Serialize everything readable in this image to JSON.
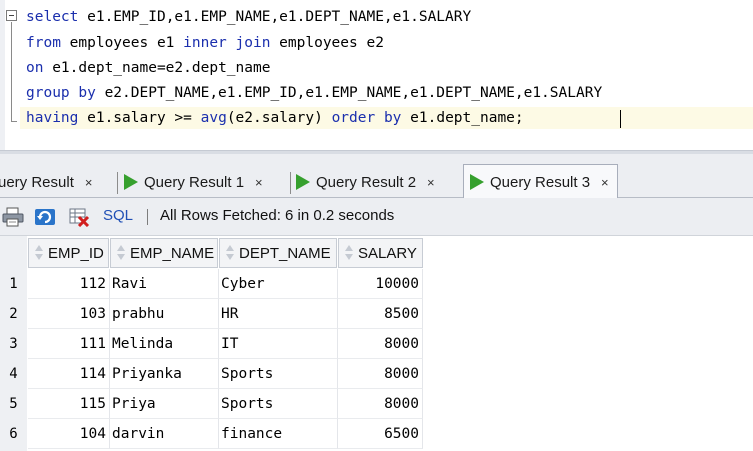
{
  "editor": {
    "lines": [
      [
        {
          "t": "select",
          "k": true
        },
        {
          "t": " e1.EMP_ID,e1.EMP_NAME,e1.DEPT_NAME,e1.SALARY",
          "k": false
        }
      ],
      [
        {
          "t": "from",
          "k": true
        },
        {
          "t": " employees e1 ",
          "k": false
        },
        {
          "t": "inner join",
          "k": true
        },
        {
          "t": " employees e2",
          "k": false
        }
      ],
      [
        {
          "t": "on",
          "k": true
        },
        {
          "t": " e1.dept_name=e2.dept_name",
          "k": false
        }
      ],
      [
        {
          "t": "group by",
          "k": true
        },
        {
          "t": " e2.DEPT_NAME,e1.EMP_ID,e1.EMP_NAME,e1.DEPT_NAME,e1.SALARY",
          "k": false
        }
      ],
      [
        {
          "t": "having",
          "k": true
        },
        {
          "t": " e1.salary >= ",
          "k": false
        },
        {
          "t": "avg",
          "k": true
        },
        {
          "t": "(e2.salary) ",
          "k": false
        },
        {
          "t": "order by",
          "k": true
        },
        {
          "t": " e1.dept_name;",
          "k": false
        }
      ]
    ],
    "fold_icon": "minus-box-icon"
  },
  "tabs": [
    {
      "label": "uery Result",
      "close": "×",
      "icon": null
    },
    {
      "label": "Query Result 1",
      "close": "×",
      "icon": "play-icon"
    },
    {
      "label": "Query Result 2",
      "close": "×",
      "icon": "play-icon"
    },
    {
      "label": "Query Result 3",
      "close": "×",
      "icon": "play-icon",
      "active": true
    }
  ],
  "toolbar": {
    "icons": [
      "print-icon",
      "refresh-icon",
      "delete-icon"
    ],
    "sql_label": "SQL",
    "status": "All Rows Fetched: 6 in 0.2 seconds"
  },
  "grid": {
    "columns": [
      "EMP_ID",
      "EMP_NAME",
      "DEPT_NAME",
      "SALARY"
    ],
    "rows": [
      {
        "n": "1",
        "cells": [
          "112",
          "Ravi",
          "Cyber",
          "10000"
        ]
      },
      {
        "n": "2",
        "cells": [
          "103",
          "prabhu",
          "HR",
          "8500"
        ]
      },
      {
        "n": "3",
        "cells": [
          "111",
          "Melinda",
          "IT",
          "8000"
        ]
      },
      {
        "n": "4",
        "cells": [
          "114",
          "Priyanka",
          "Sports",
          "8000"
        ]
      },
      {
        "n": "5",
        "cells": [
          "115",
          "Priya",
          "Sports",
          "8000"
        ]
      },
      {
        "n": "6",
        "cells": [
          "104",
          "darvin",
          "finance",
          "6500"
        ]
      }
    ]
  },
  "colors": {
    "keyword": "#1b2fad",
    "tab_play": "#36a02e",
    "sql_link": "#1f4fb5",
    "current_line": "#fdfae5"
  }
}
